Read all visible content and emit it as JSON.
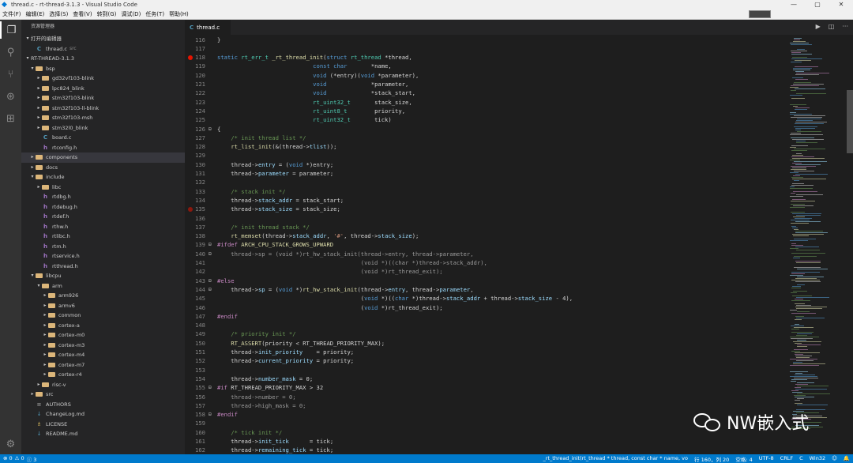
{
  "window": {
    "title": "thread.c - rt-thread-3.1.3 - Visual Studio Code"
  },
  "menu": [
    "文件(F)",
    "编辑(E)",
    "选择(S)",
    "查看(V)",
    "转到(G)",
    "调试(D)",
    "任务(T)",
    "帮助(H)"
  ],
  "sidebar": {
    "title": "资源管理器",
    "open_editors_label": "打开的编辑器",
    "open_file": {
      "name": "thread.c",
      "folder": "src"
    },
    "project_label": "RT-THREAD-3.1.3",
    "tree": [
      {
        "label": "bsp",
        "depth": 1,
        "kind": "folder",
        "open": true
      },
      {
        "label": "gd32vf103-blink",
        "depth": 2,
        "kind": "folder",
        "open": false
      },
      {
        "label": "lpc824_blink",
        "depth": 2,
        "kind": "folder",
        "open": false
      },
      {
        "label": "stm32f103-blink",
        "depth": 2,
        "kind": "folder",
        "open": false
      },
      {
        "label": "stm32f103-ll-blink",
        "depth": 2,
        "kind": "folder",
        "open": false
      },
      {
        "label": "stm32f103-msh",
        "depth": 2,
        "kind": "folder",
        "open": false
      },
      {
        "label": "stm32l0_blink",
        "depth": 2,
        "kind": "folder",
        "open": false
      },
      {
        "label": "board.c",
        "depth": 2,
        "kind": "c"
      },
      {
        "label": "rtconfig.h",
        "depth": 2,
        "kind": "h"
      },
      {
        "label": "components",
        "depth": 1,
        "kind": "folder",
        "open": false,
        "selected": true
      },
      {
        "label": "docs",
        "depth": 1,
        "kind": "folder",
        "open": false
      },
      {
        "label": "include",
        "depth": 1,
        "kind": "folder",
        "open": true
      },
      {
        "label": "libc",
        "depth": 2,
        "kind": "folder",
        "open": false
      },
      {
        "label": "rtdbg.h",
        "depth": 2,
        "kind": "h"
      },
      {
        "label": "rtdebug.h",
        "depth": 2,
        "kind": "h"
      },
      {
        "label": "rtdef.h",
        "depth": 2,
        "kind": "h"
      },
      {
        "label": "rthw.h",
        "depth": 2,
        "kind": "h"
      },
      {
        "label": "rtlibc.h",
        "depth": 2,
        "kind": "h"
      },
      {
        "label": "rtm.h",
        "depth": 2,
        "kind": "h"
      },
      {
        "label": "rtservice.h",
        "depth": 2,
        "kind": "h"
      },
      {
        "label": "rtthread.h",
        "depth": 2,
        "kind": "h"
      },
      {
        "label": "libcpu",
        "depth": 1,
        "kind": "folder",
        "open": true
      },
      {
        "label": "arm",
        "depth": 2,
        "kind": "folder",
        "open": true
      },
      {
        "label": "arm926",
        "depth": 3,
        "kind": "folder",
        "open": false
      },
      {
        "label": "armv6",
        "depth": 3,
        "kind": "folder",
        "open": false
      },
      {
        "label": "common",
        "depth": 3,
        "kind": "folder",
        "open": false
      },
      {
        "label": "cortex-a",
        "depth": 3,
        "kind": "folder",
        "open": false
      },
      {
        "label": "cortex-m0",
        "depth": 3,
        "kind": "folder",
        "open": false
      },
      {
        "label": "cortex-m3",
        "depth": 3,
        "kind": "folder",
        "open": false
      },
      {
        "label": "cortex-m4",
        "depth": 3,
        "kind": "folder",
        "open": false
      },
      {
        "label": "cortex-m7",
        "depth": 3,
        "kind": "folder",
        "open": false
      },
      {
        "label": "cortex-r4",
        "depth": 3,
        "kind": "folder",
        "open": false
      },
      {
        "label": "risc-v",
        "depth": 2,
        "kind": "folder",
        "open": false
      },
      {
        "label": "src",
        "depth": 1,
        "kind": "folder",
        "open": false
      },
      {
        "label": "AUTHORS",
        "depth": 1,
        "kind": "doc"
      },
      {
        "label": "ChangeLog.md",
        "depth": 1,
        "kind": "md"
      },
      {
        "label": "LICENSE",
        "depth": 1,
        "kind": "lic"
      },
      {
        "label": "README.md",
        "depth": 1,
        "kind": "md"
      }
    ]
  },
  "tab": {
    "label": "thread.c"
  },
  "editor": {
    "lines": [
      {
        "n": "116",
        "html": "}"
      },
      {
        "n": "117",
        "html": ""
      },
      {
        "n": "118",
        "bp": true,
        "html": "<span class=\"kw\">static</span> <span class=\"ty\">rt_err_t</span> <span class=\"fn\">_rt_thread_init</span>(<span class=\"kw\">struct</span> <span class=\"ty\">rt_thread</span> *thread,"
      },
      {
        "n": "119",
        "html": "                            <span class=\"kw\">const</span> <span class=\"kw\">char</span>       *name,"
      },
      {
        "n": "120",
        "html": "                            <span class=\"kw\">void</span> (*entry)(<span class=\"kw\">void</span> *parameter),"
      },
      {
        "n": "121",
        "html": "                            <span class=\"kw\">void</span>             *parameter,"
      },
      {
        "n": "122",
        "html": "                            <span class=\"kw\">void</span>             *stack_start,"
      },
      {
        "n": "123",
        "html": "                            <span class=\"ty\">rt_uint32_t</span>       stack_size,"
      },
      {
        "n": "124",
        "html": "                            <span class=\"ty\">rt_uint8_t</span>        priority,"
      },
      {
        "n": "125",
        "html": "                            <span class=\"ty\">rt_uint32_t</span>       tick)"
      },
      {
        "n": "126",
        "fold": true,
        "html": "{"
      },
      {
        "n": "127",
        "html": "    <span class=\"cm\">/* init thread list */</span>"
      },
      {
        "n": "128",
        "html": "    <span class=\"fn\">rt_list_init</span>(&amp;(thread-&gt;<span class=\"mem\">tlist</span>));"
      },
      {
        "n": "129",
        "html": ""
      },
      {
        "n": "130",
        "html": "    thread-&gt;<span class=\"mem\">entry</span> = (<span class=\"kw\">void</span> *)entry;"
      },
      {
        "n": "131",
        "html": "    thread-&gt;<span class=\"mem\">parameter</span> = parameter;"
      },
      {
        "n": "132",
        "html": ""
      },
      {
        "n": "133",
        "html": "    <span class=\"cm\">/* stack init */</span>"
      },
      {
        "n": "134",
        "html": "    thread-&gt;<span class=\"mem\">stack_addr</span> = stack_start;"
      },
      {
        "n": "135",
        "bp": true,
        "bpdim": true,
        "html": "    thread-&gt;<span class=\"mem\">stack_size</span> = stack_size;"
      },
      {
        "n": "136",
        "html": ""
      },
      {
        "n": "137",
        "html": "    <span class=\"cm\">/* init thread stack */</span>"
      },
      {
        "n": "138",
        "html": "    <span class=\"fn\">rt_memset</span>(thread-&gt;<span class=\"mem\">stack_addr</span>, <span class=\"str\">'#'</span>, thread-&gt;<span class=\"mem\">stack_size</span>);"
      },
      {
        "n": "139",
        "fold": true,
        "html": "<span class=\"pp\">#ifdef</span> <span class=\"fn\">ARCH_CPU_STACK_GROWS_UPWARD</span>"
      },
      {
        "n": "140",
        "fold": true,
        "html": "<span class=\"dim\">    thread-&gt;sp = (void *)rt_hw_stack_init(thread-&gt;entry, thread-&gt;parameter,</span>"
      },
      {
        "n": "141",
        "html": "<span class=\"dim\">                                          (void *)((char *)thread-&gt;stack_addr),</span>"
      },
      {
        "n": "142",
        "html": "<span class=\"dim\">                                          (void *)rt_thread_exit);</span>"
      },
      {
        "n": "143",
        "fold": true,
        "html": "<span class=\"pp\">#else</span>"
      },
      {
        "n": "144",
        "fold": true,
        "html": "    thread-&gt;<span class=\"mem\">sp</span> = (<span class=\"kw\">void</span> *)<span class=\"fn\">rt_hw_stack_init</span>(thread-&gt;<span class=\"mem\">entry</span>, thread-&gt;<span class=\"mem\">parameter</span>,"
      },
      {
        "n": "145",
        "html": "                                          (<span class=\"kw\">void</span> *)((<span class=\"kw\">char</span> *)thread-&gt;<span class=\"mem\">stack_addr</span> + thread-&gt;<span class=\"mem\">stack_size</span> - 4),"
      },
      {
        "n": "146",
        "html": "                                          (<span class=\"kw\">void</span> *)rt_thread_exit);"
      },
      {
        "n": "147",
        "html": "<span class=\"pp\">#endif</span>"
      },
      {
        "n": "148",
        "html": ""
      },
      {
        "n": "149",
        "html": "    <span class=\"cm\">/* priority init */</span>"
      },
      {
        "n": "150",
        "html": "    <span class=\"fn\">RT_ASSERT</span>(priority &lt; RT_THREAD_PRIORITY_MAX);"
      },
      {
        "n": "151",
        "html": "    thread-&gt;<span class=\"mem\">init_priority</span>    = priority;"
      },
      {
        "n": "152",
        "html": "    thread-&gt;<span class=\"mem\">current_priority</span> = priority;"
      },
      {
        "n": "153",
        "html": ""
      },
      {
        "n": "154",
        "html": "    thread-&gt;<span class=\"mem\">number_mask</span> = 0;"
      },
      {
        "n": "155",
        "fold": true,
        "html": "<span class=\"pp\">#if</span> RT_THREAD_PRIORITY_MAX &gt; 32"
      },
      {
        "n": "156",
        "html": "<span class=\"dim\">    thread-&gt;number = 0;</span>"
      },
      {
        "n": "157",
        "html": "<span class=\"dim\">    thread-&gt;high_mask = 0;</span>"
      },
      {
        "n": "158",
        "fold": true,
        "html": "<span class=\"pp\">#endif</span>"
      },
      {
        "n": "159",
        "html": ""
      },
      {
        "n": "160",
        "html": "    <span class=\"cm\">/* tick init */</span>"
      },
      {
        "n": "161",
        "html": "    thread-&gt;<span class=\"mem\">init_tick</span>      = tick;"
      },
      {
        "n": "162",
        "html": "    thread-&gt;<span class=\"mem\">remaining_tick</span> = tick;"
      }
    ]
  },
  "status": {
    "left": [
      "⊗ 0",
      "⚠ 0",
      "ⓘ 3"
    ],
    "right": [
      "_rt_thread_init(rt_thread * thread, const char * name, vo",
      "行 160，列 20",
      "空格: 4",
      "UTF-8",
      "CRLF",
      "C",
      "Win32",
      "☺",
      "🔔"
    ]
  },
  "watermark": {
    "text": "NW嵌入式"
  },
  "colors": {
    "accent": "#007acc",
    "breakpoint": "#e51400",
    "folder": "#dcb67a"
  }
}
